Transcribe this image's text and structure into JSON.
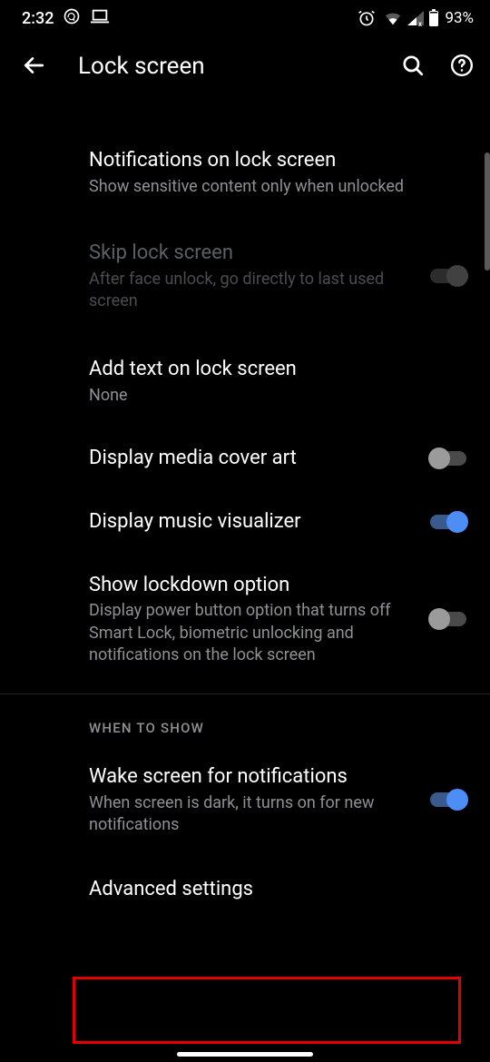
{
  "statusbar": {
    "time": "2:32",
    "battery": "93%"
  },
  "header": {
    "title": "Lock screen"
  },
  "rows": {
    "notifications": {
      "title": "Notifications on lock screen",
      "sub": "Show sensitive content only when unlocked"
    },
    "skip": {
      "title": "Skip lock screen",
      "sub": "After face unlock, go directly to last used screen"
    },
    "addtext": {
      "title": "Add text on lock screen",
      "sub": "None"
    },
    "coverart": {
      "title": "Display media cover art"
    },
    "visualizer": {
      "title": "Display music visualizer"
    },
    "lockdown": {
      "title": "Show lockdown option",
      "sub": "Display power button option that turns off Smart Lock, biometric unlocking and notifications on the lock screen"
    },
    "wake": {
      "title": "Wake screen for notifications",
      "sub": "When screen is dark, it turns on for new notifications"
    },
    "advanced": {
      "title": "Advanced settings"
    }
  },
  "section": {
    "whentoshow": "WHEN TO SHOW"
  }
}
